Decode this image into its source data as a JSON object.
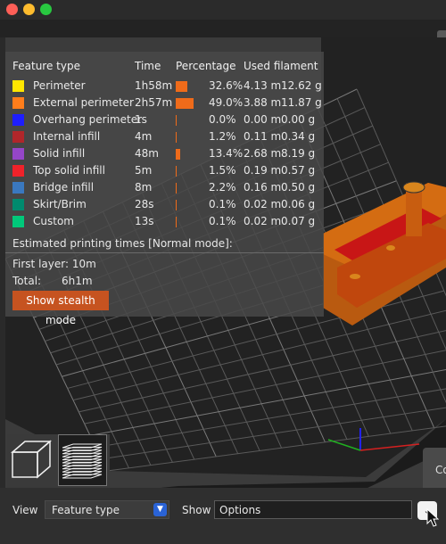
{
  "legend": {
    "headers": {
      "feature_type": "Feature type",
      "time": "Time",
      "percentage": "Percentage",
      "used_filament": "Used filament"
    },
    "rows": [
      {
        "name": "Perimeter",
        "time": "1h58m",
        "percentage": "32.6%",
        "length": "4.13 m",
        "weight": "12.62 g",
        "color": "#ffe600",
        "fraction": 0.326
      },
      {
        "name": "External perimeter",
        "time": "2h57m",
        "percentage": "49.0%",
        "length": "3.88 m",
        "weight": "11.87 g",
        "color": "#ff7d1b",
        "fraction": 0.49
      },
      {
        "name": "Overhang perimeter",
        "time": "1s",
        "percentage": "0.0%",
        "length": "0.00 m",
        "weight": "0.00 g",
        "color": "#1e1eff",
        "fraction": 0.0
      },
      {
        "name": "Internal infill",
        "time": "4m",
        "percentage": "1.2%",
        "length": "0.11 m",
        "weight": "0.34 g",
        "color": "#b0262a",
        "fraction": 0.012
      },
      {
        "name": "Solid infill",
        "time": "48m",
        "percentage": "13.4%",
        "length": "2.68 m",
        "weight": "8.19 g",
        "color": "#9546c8",
        "fraction": 0.134
      },
      {
        "name": "Top solid infill",
        "time": "5m",
        "percentage": "1.5%",
        "length": "0.19 m",
        "weight": "0.57 g",
        "color": "#f0222a",
        "fraction": 0.015
      },
      {
        "name": "Bridge infill",
        "time": "8m",
        "percentage": "2.2%",
        "length": "0.16 m",
        "weight": "0.50 g",
        "color": "#3a78bf",
        "fraction": 0.022
      },
      {
        "name": "Skirt/Brim",
        "time": "28s",
        "percentage": "0.1%",
        "length": "0.02 m",
        "weight": "0.06 g",
        "color": "#008a6e",
        "fraction": 0.001
      },
      {
        "name": "Custom",
        "time": "13s",
        "percentage": "0.1%",
        "length": "0.02 m",
        "weight": "0.07 g",
        "color": "#00c87a",
        "fraction": 0.001
      }
    ],
    "estimated_title": "Estimated printing times [Normal mode]:",
    "first_layer": "First layer: 10m",
    "total_label": "Total:",
    "total_value": "6h1m",
    "stealth_button": "Show stealth mode"
  },
  "bottom": {
    "view_label": "View",
    "view_value": "Feature type",
    "show_label": "Show",
    "show_value": "Options"
  },
  "right_tab_label": "Co",
  "icons": {
    "view_combo_arrow": "chevron-down-icon",
    "options_button": "chevron-down-icon",
    "iso_view": "cube-icon",
    "layers_view": "layers-icon"
  }
}
